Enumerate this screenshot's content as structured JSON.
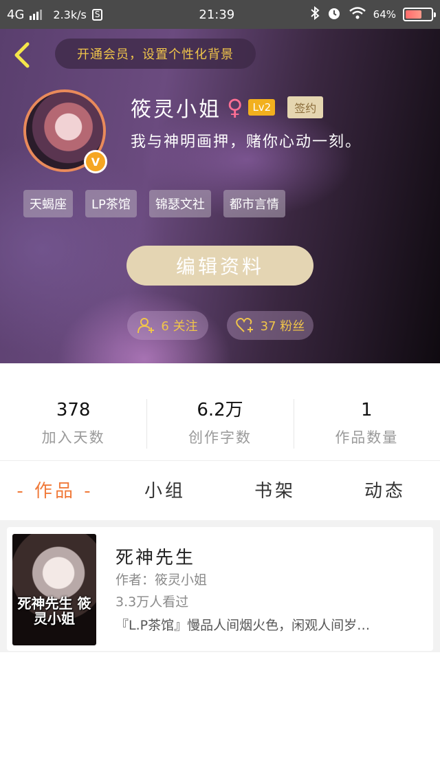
{
  "status_bar": {
    "network": "4G",
    "speed": "2.3k/s",
    "app_indicator": "S",
    "time": "21:39",
    "battery": "64%",
    "battery_level": 0.64,
    "icons": [
      "signal-icon",
      "bluetooth-icon",
      "alarm-icon",
      "wifi-icon",
      "battery-icon"
    ]
  },
  "header": {
    "vip_banner": "开通会员，设置个性化背景",
    "username": "筱灵小姐",
    "gender_symbol": "♀",
    "level": "Lv2",
    "sign_badge": "签约",
    "verified_badge": "V",
    "bio": "我与神明画押，赌你心动一刻。",
    "tags": [
      "天蝎座",
      "LP茶馆",
      "锦瑟文社",
      "都市言情"
    ],
    "edit_button": "编辑资料",
    "following": "6 关注",
    "fans": "37 粉丝"
  },
  "stats": [
    {
      "value": "378",
      "label": "加入天数"
    },
    {
      "value": "6.2万",
      "label": "创作字数"
    },
    {
      "value": "1",
      "label": "作品数量"
    }
  ],
  "tabs": [
    {
      "label": "- 作品 -",
      "active": true
    },
    {
      "label": "小组",
      "active": false
    },
    {
      "label": "书架",
      "active": false
    },
    {
      "label": "动态",
      "active": false
    }
  ],
  "works": [
    {
      "title": "死神先生",
      "author": "作者：筱灵小姐",
      "views": "3.3万人看过",
      "description": "『L.P茶馆』慢品人间烟火色，闲观人间岁…",
      "cover_text": "死神先生 筱灵小姐"
    }
  ],
  "colors": {
    "accent_orange": "#f07a3a",
    "gold": "#f0c54a",
    "edit_button_bg": "#e4d5b3"
  }
}
